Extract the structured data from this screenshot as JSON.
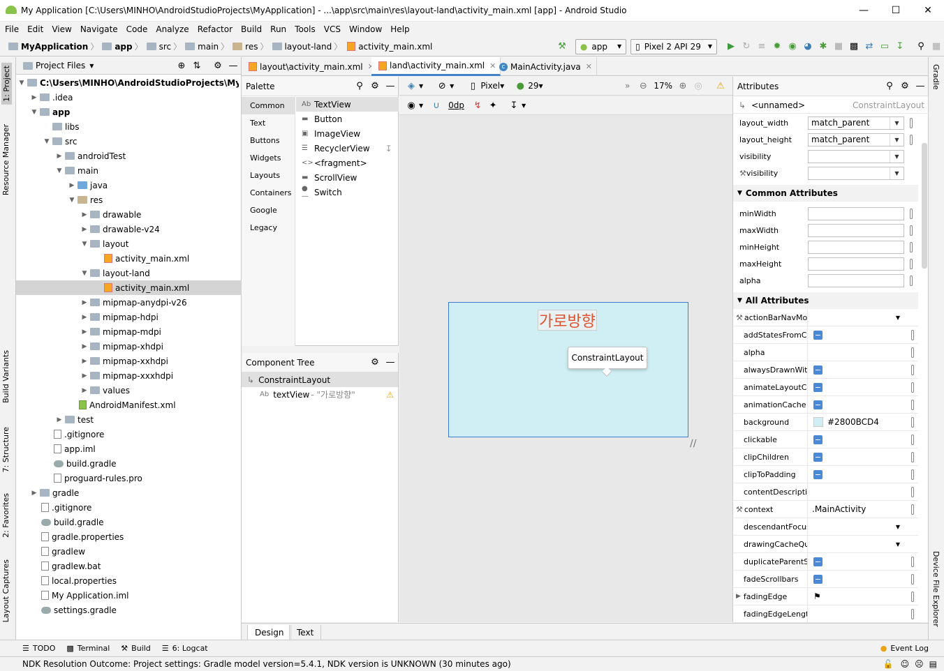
{
  "window": {
    "title": "My Application [C:\\Users\\MINHO\\AndroidStudioProjects\\MyApplication] - ...\\app\\src\\main\\res\\layout-land\\activity_main.xml [app] - Android Studio"
  },
  "menu": [
    "File",
    "Edit",
    "View",
    "Navigate",
    "Code",
    "Analyze",
    "Refactor",
    "Build",
    "Run",
    "Tools",
    "VCS",
    "Window",
    "Help"
  ],
  "breadcrumb": [
    "MyApplication",
    "app",
    "src",
    "main",
    "res",
    "layout-land",
    "activity_main.xml"
  ],
  "toolbar": {
    "run_config": "app",
    "device": "Pixel 2 API 29"
  },
  "left_tool_tabs": [
    "1: Project",
    "Resource Manager",
    "Build Variants",
    "7: Structure",
    "2: Favorites",
    "Layout Captures"
  ],
  "right_tool_tabs": [
    "Gradle",
    "Device File Explorer"
  ],
  "project": {
    "header": "Project Files",
    "root": "C:\\Users\\MINHO\\AndroidStudioProjects\\MyApplication",
    "tree": [
      ".idea",
      "app",
      "libs",
      "src",
      "androidTest",
      "main",
      "java",
      "res",
      "drawable",
      "drawable-v24",
      "layout",
      "activity_main.xml",
      "layout-land",
      "activity_main.xml",
      "mipmap-anydpi-v26",
      "mipmap-hdpi",
      "mipmap-mdpi",
      "mipmap-xhdpi",
      "mipmap-xxhdpi",
      "mipmap-xxxhdpi",
      "values",
      "AndroidManifest.xml",
      "test",
      ".gitignore",
      "app.iml",
      "build.gradle",
      "proguard-rules.pro",
      "gradle",
      ".gitignore",
      "build.gradle",
      "gradle.properties",
      "gradlew",
      "gradlew.bat",
      "local.properties",
      "My Application.iml",
      "settings.gradle"
    ]
  },
  "editor_tabs": [
    "layout\\activity_main.xml",
    "land\\activity_main.xml",
    "MainActivity.java"
  ],
  "palette": {
    "title": "Palette",
    "categories": [
      "Common",
      "Text",
      "Buttons",
      "Widgets",
      "Layouts",
      "Containers",
      "Google",
      "Legacy"
    ],
    "items": [
      "TextView",
      "Button",
      "ImageView",
      "RecyclerView",
      "<fragment>",
      "ScrollView",
      "Switch"
    ]
  },
  "component_tree": {
    "title": "Component Tree",
    "root": "ConstraintLayout",
    "child": "textView",
    "child_text": "- \"가로방향\""
  },
  "design_toolbar": {
    "device": "Pixel",
    "api": "29",
    "zoom": "17%",
    "margin": "0dp"
  },
  "canvas": {
    "text": "가로방향",
    "tooltip": "ConstraintLayout"
  },
  "attributes": {
    "title": "Attributes",
    "component": "<unnamed>",
    "component_type": "ConstraintLayout",
    "top_rows": [
      {
        "name": "layout_width",
        "value": "match_parent"
      },
      {
        "name": "layout_height",
        "value": "match_parent"
      },
      {
        "name": "visibility",
        "value": ""
      },
      {
        "name": "visibility",
        "value": ""
      }
    ],
    "common_header": "Common Attributes",
    "common_rows": [
      "minWidth",
      "maxWidth",
      "minHeight",
      "maxHeight",
      "alpha"
    ],
    "all_header": "All Attributes",
    "all_rows": [
      {
        "name": "actionBarNavMod",
        "value": ""
      },
      {
        "name": "addStatesFromCh",
        "value": ""
      },
      {
        "name": "alpha",
        "value": ""
      },
      {
        "name": "alwaysDrawnWithC",
        "value": ""
      },
      {
        "name": "animateLayoutCha",
        "value": ""
      },
      {
        "name": "animationCache",
        "value": ""
      },
      {
        "name": "background",
        "value": "#2800BCD4"
      },
      {
        "name": "clickable",
        "value": ""
      },
      {
        "name": "clipChildren",
        "value": ""
      },
      {
        "name": "clipToPadding",
        "value": ""
      },
      {
        "name": "contentDescriptio",
        "value": ""
      },
      {
        "name": "context",
        "value": ".MainActivity"
      },
      {
        "name": "descendantFocusa",
        "value": ""
      },
      {
        "name": "drawingCacheQua",
        "value": ""
      },
      {
        "name": "duplicateParentSt",
        "value": ""
      },
      {
        "name": "fadeScrollbars",
        "value": ""
      },
      {
        "name": "fadingEdge",
        "value": ""
      },
      {
        "name": "fadingEdgeLength",
        "value": ""
      }
    ]
  },
  "bottom_tabs": [
    "Design",
    "Text"
  ],
  "tool_windows": [
    "TODO",
    "Terminal",
    "Build",
    "6: Logcat"
  ],
  "event_log": "Event Log",
  "status": "NDK Resolution Outcome: Project settings: Gradle model version=5.4.1, NDK version is UNKNOWN (30 minutes ago)",
  "colors": {
    "accent": "#4083c9",
    "canvas": "#d0eff4",
    "canvas_text": "#e0522e",
    "checkbox": "#4a89d6"
  }
}
